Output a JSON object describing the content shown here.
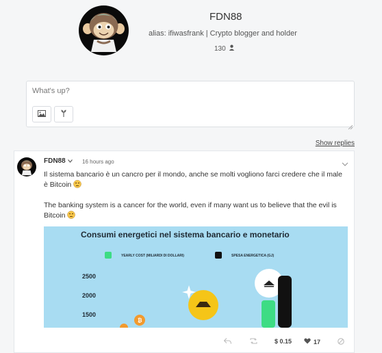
{
  "profile": {
    "name": "FDN88",
    "alias_line": "alias: ifiwasfrank | Crypto blogger and holder",
    "followers": "130"
  },
  "composer": {
    "placeholder": "What's up?"
  },
  "show_replies": "Show replies",
  "post": {
    "author": "FDN88",
    "time": "16 hours ago",
    "paragraph_it": "Il sistema bancario è un cancro per il mondo, anche se molti vogliono farci credere che il male è Bitcoin",
    "paragraph_en": "The banking system is a cancer for the world, even if many want us to believe that the evil is Bitcoin",
    "image": {
      "title": "Consumi energetici nel sistema bancario e monetario",
      "legend": [
        "YEARLY COST (MILIARDI DI DOLLARI)",
        "SPESA ENERGETICA (GJ)"
      ],
      "legend_colors": [
        "#3ddc84",
        "#111111"
      ],
      "ticks": [
        "2500",
        "2000",
        "1500"
      ]
    },
    "footer": {
      "value": "$ 0.15",
      "likes": "17"
    }
  },
  "colors": {
    "background": "#f5f6f7",
    "card": "#ffffff",
    "chart_bg": "#a8dcf2",
    "coin_yellow": "#f5c518",
    "bitcoin_orange": "#f29a2e"
  },
  "icons": [
    "user-icon",
    "image-icon",
    "plant-icon",
    "chevron-down-icon",
    "reply-icon",
    "reblog-icon",
    "heart-icon",
    "flag-icon",
    "emoji-unamused"
  ]
}
